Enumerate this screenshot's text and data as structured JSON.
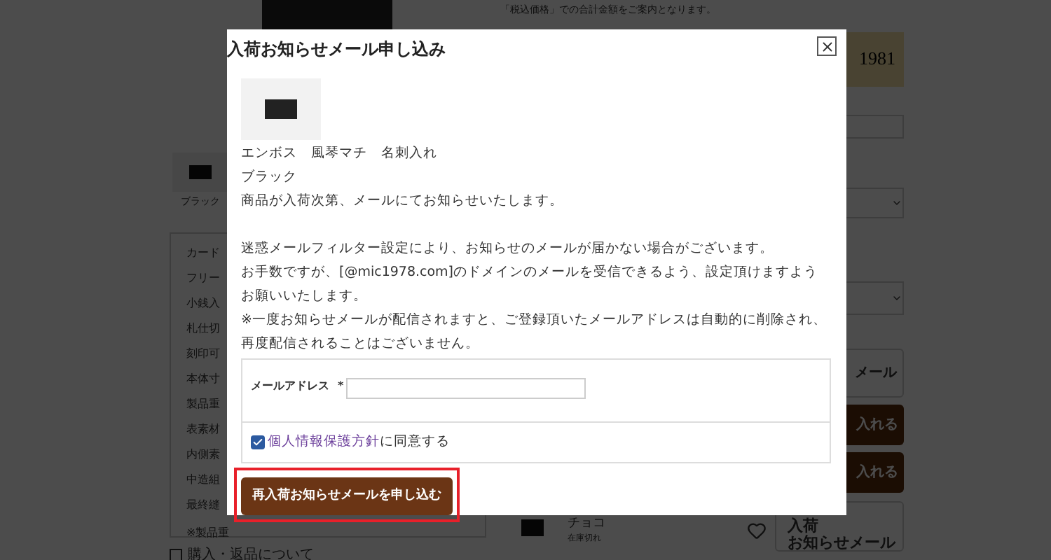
{
  "page": {
    "price_note": "「税込価格」での合計金額をご案内となります。",
    "brand_badge": "1981",
    "swatch_label": "ブラック",
    "spec_items": [
      "カード",
      "フリー",
      "小銭入",
      "札仕切",
      "刻印可",
      "本体寸",
      "製品重",
      "表素材",
      "内側素",
      "中造組",
      "最終縫"
    ],
    "spec_note": "※製品重",
    "footer_link": "購入・返品について",
    "side_buttons": [
      {
        "kind": "outline",
        "label": "メール"
      },
      {
        "kind": "filled",
        "label": "入れる"
      },
      {
        "kind": "filled",
        "label": "入れる"
      }
    ],
    "variant": {
      "name": "チョコ",
      "stock": "在庫切れ",
      "favorite": false,
      "button_lines": [
        "入荷",
        "お知らせメール"
      ]
    }
  },
  "modal": {
    "title": "入荷お知らせメール申し込み",
    "product_name": "エンボス　風琴マチ　名刺入れ",
    "product_color": "ブラック",
    "message": "商品が入荷次第、メールにてお知らせいたします。",
    "notices": [
      "迷惑メールフィルター設定により、お知らせのメールが届かない場合がございます。",
      "お手数ですが、[@mic1978.com]のドメインのメールを受信できるよう、設定頂けますようお願いいたします。",
      "※一度お知らせメールが配信されますと、ご登録頂いたメールアドレスは自動的に削除され、再度配信されることはございません。"
    ],
    "email": {
      "label": "メールアドレス",
      "required_mark": "*"
    },
    "consent": {
      "checked": true,
      "link": "個人情報保護方針",
      "text": "に同意する"
    },
    "submit": {
      "label": "再入荷お知らせメールを申し込む",
      "highlighted": true
    }
  }
}
